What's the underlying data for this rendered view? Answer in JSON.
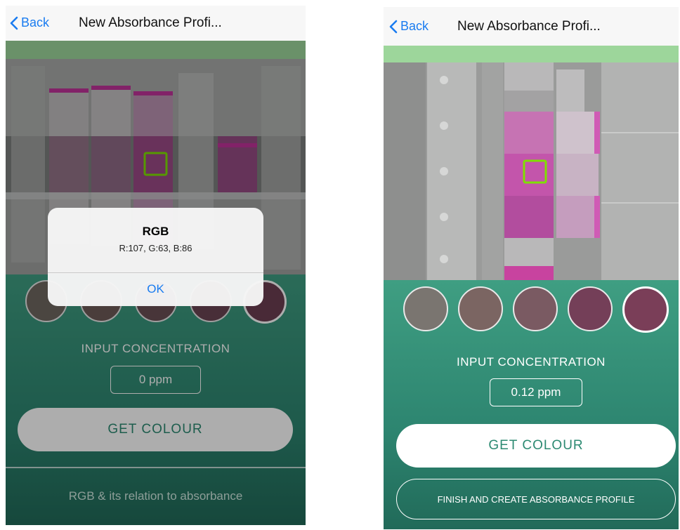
{
  "left": {
    "nav": {
      "back_label": "Back",
      "title": "New Absorbance Profi..."
    },
    "concentration": {
      "label": "INPUT CONCENTRATION",
      "value": "0 ppm"
    },
    "get_colour_label": "GET COLOUR",
    "footer_text": "RGB & its relation to absorbance",
    "alert": {
      "title": "RGB",
      "message": "R:107, G:63, B:86",
      "ok_label": "OK"
    },
    "swatch_colors": [
      "#6f6860",
      "#6d5a58",
      "#6a4e55",
      "#6a4553",
      "#6c3f52"
    ]
  },
  "right": {
    "nav": {
      "back_label": "Back",
      "title": "New Absorbance Profi..."
    },
    "concentration": {
      "label": "INPUT CONCENTRATION",
      "value": "0.12 ppm"
    },
    "get_colour_label": "GET COLOUR",
    "finish_label": "FINISH AND CREATE ABSORBANCE PROFILE",
    "swatch_colors": [
      "#7a7570",
      "#7b6562",
      "#7a5a62",
      "#743f58",
      "#7a3e58"
    ]
  },
  "colors": {
    "accent": "#1a7cf0",
    "panel_green": "#2d8570",
    "green_strip": "#9dd69b",
    "selection_box": "#7fe000"
  }
}
